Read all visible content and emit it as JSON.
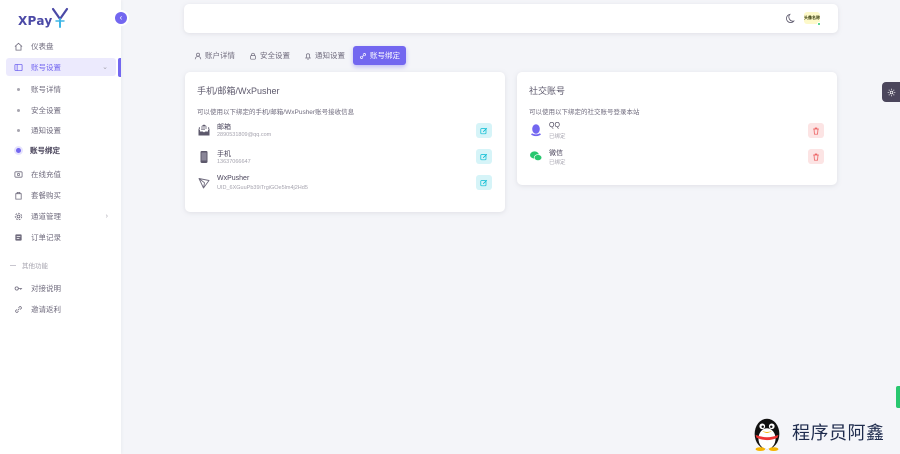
{
  "brand": {
    "name": "XPay"
  },
  "sidebar": {
    "items": [
      {
        "label": "仪表盘",
        "icon": "home-icon"
      },
      {
        "label": "账号设置",
        "icon": "account-settings-icon"
      },
      {
        "label": "在线充值",
        "icon": "recharge-icon"
      },
      {
        "label": "套餐购买",
        "icon": "package-icon"
      },
      {
        "label": "通道管理",
        "icon": "channel-icon"
      },
      {
        "label": "订单记录",
        "icon": "order-icon"
      }
    ],
    "sub_items": [
      {
        "label": "账号详情"
      },
      {
        "label": "安全设置"
      },
      {
        "label": "通知设置"
      },
      {
        "label": "账号绑定"
      }
    ],
    "section_label": "其他功能",
    "other_items": [
      {
        "label": "对接说明",
        "icon": "key-icon"
      },
      {
        "label": "邀请返利",
        "icon": "link-icon"
      }
    ]
  },
  "navbar": {
    "avatar_text": "头像名称"
  },
  "tabs": [
    {
      "label": "账户详情"
    },
    {
      "label": "安全设置"
    },
    {
      "label": "通知设置"
    },
    {
      "label": "账号绑定"
    }
  ],
  "bind_card": {
    "title": "手机/邮箱/WxPusher",
    "desc": "可以使用以下绑定的手机/邮箱/WxPusher账号接收信息",
    "rows": [
      {
        "name": "邮箱",
        "value": "2890531809@qq.com"
      },
      {
        "name": "手机",
        "value": "13637066647"
      },
      {
        "name": "WxPusher",
        "value": "UID_6XGuuPb39iTrgiGOe5lm4j2Hd5"
      }
    ]
  },
  "social_card": {
    "title": "社交账号",
    "desc": "可以使用以下绑定的社交账号登录本站",
    "rows": [
      {
        "name": "QQ",
        "status": "已绑定"
      },
      {
        "name": "微信",
        "status": "已绑定"
      }
    ]
  },
  "watermark": {
    "text": "程序员阿鑫"
  },
  "colors": {
    "primary": "#7367f0",
    "info": "#00cfe8",
    "danger": "#ea5455",
    "success": "#28c76f"
  }
}
